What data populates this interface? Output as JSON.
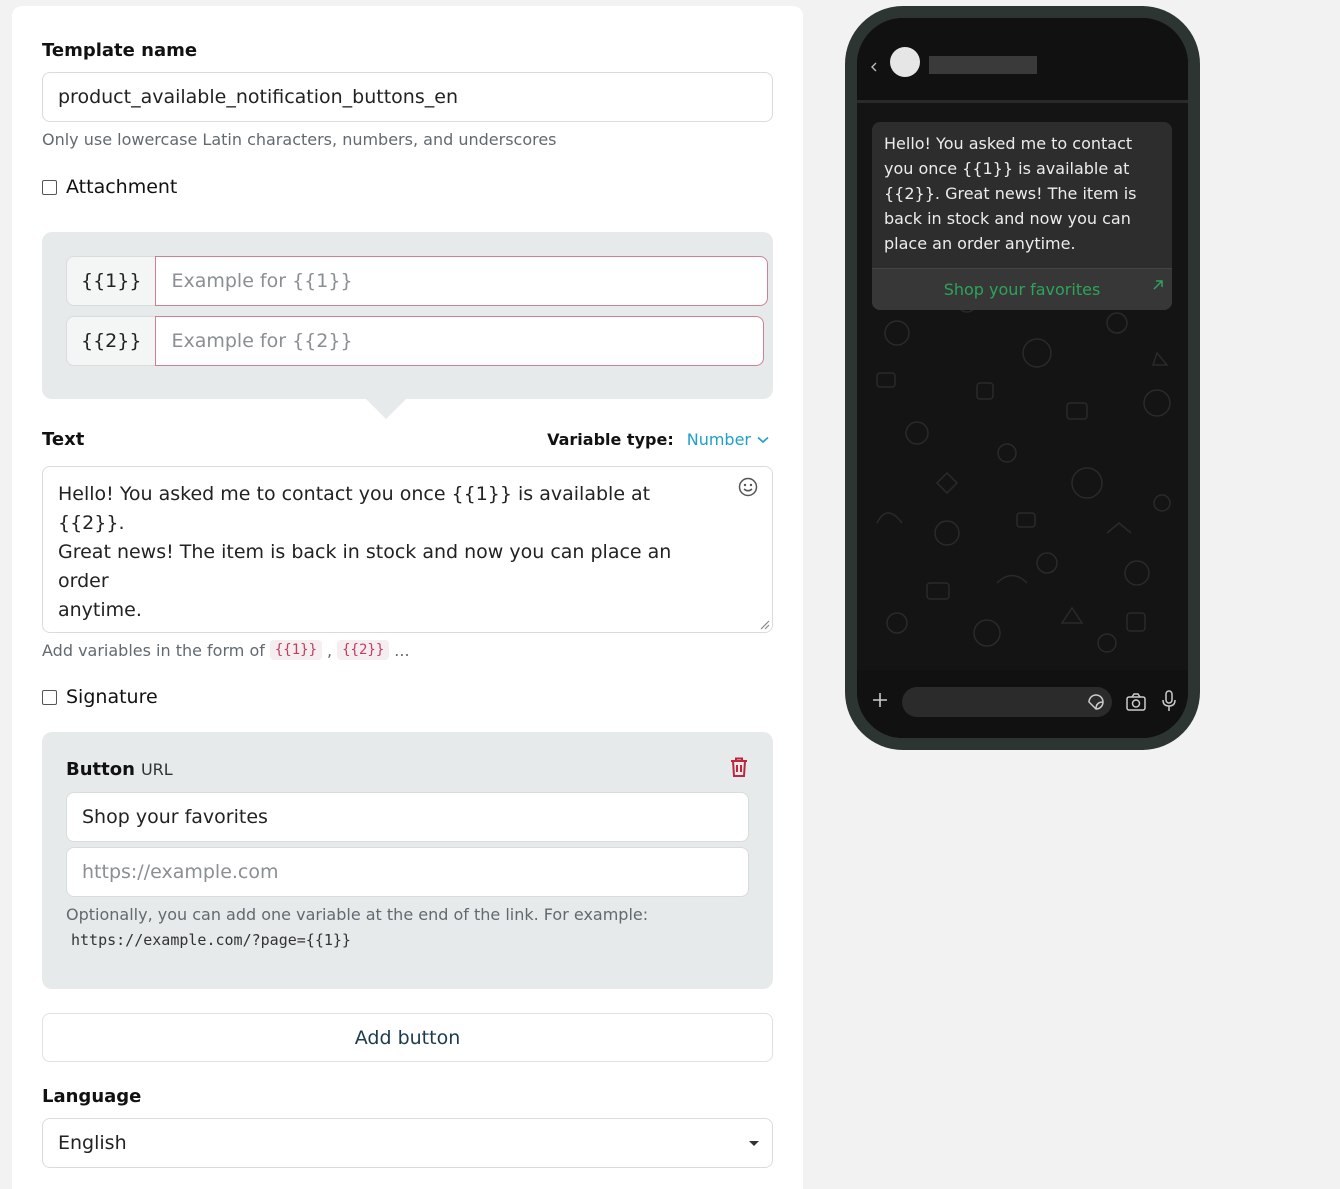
{
  "form": {
    "template_name_label": "Template name",
    "template_name_value": "product_available_notification_buttons_en",
    "template_name_hint": "Only use lowercase Latin characters, numbers, and underscores",
    "attachment_label": "Attachment",
    "variables": [
      {
        "tag": "{{1}}",
        "placeholder": "Example for {{1}}"
      },
      {
        "tag": "{{2}}",
        "placeholder": "Example for {{2}}"
      }
    ],
    "text_label": "Text",
    "variable_type_label": "Variable type:",
    "variable_type_value": "Number",
    "text_line1": "Hello! You asked me to contact you once {{1}} is available at {{2}}.",
    "text_line2": "Great news! The item is back in stock and now you can place an order",
    "text_line3": "anytime.",
    "variables_hint_prefix": "Add variables in the form of",
    "variables_hint_var1": "{{1}}",
    "variables_hint_sep": ",",
    "variables_hint_var2": "{{2}}",
    "variables_hint_suffix": "...",
    "signature_label": "Signature",
    "button_title": "Button",
    "button_type": "URL",
    "button_text_value": "Shop your favorites",
    "button_url_placeholder": "https://example.com",
    "button_url_hint": "Optionally, you can add one variable at the end of the link. For example:",
    "button_url_example": "https://example.com/?page={{1}}",
    "add_button_label": "Add button",
    "language_label": "Language",
    "language_value": "English"
  },
  "preview": {
    "message_text": "Hello! You asked me to contact you once {{1}} is available at {{2}}. Great news! The item is back in stock and now you can place an order anytime.",
    "button_label": "Shop your favorites",
    "icons": [
      "back-chevron-icon",
      "avatar",
      "plus-icon",
      "sticker-icon",
      "camera-icon",
      "mic-icon",
      "external-link-icon"
    ]
  },
  "colors": {
    "accent_blue": "#1ea0c8",
    "invalid_border": "#d37f92",
    "delete_red": "#c0253f",
    "whatsapp_green": "#2da35b",
    "grey_box": "#e6eaea"
  }
}
